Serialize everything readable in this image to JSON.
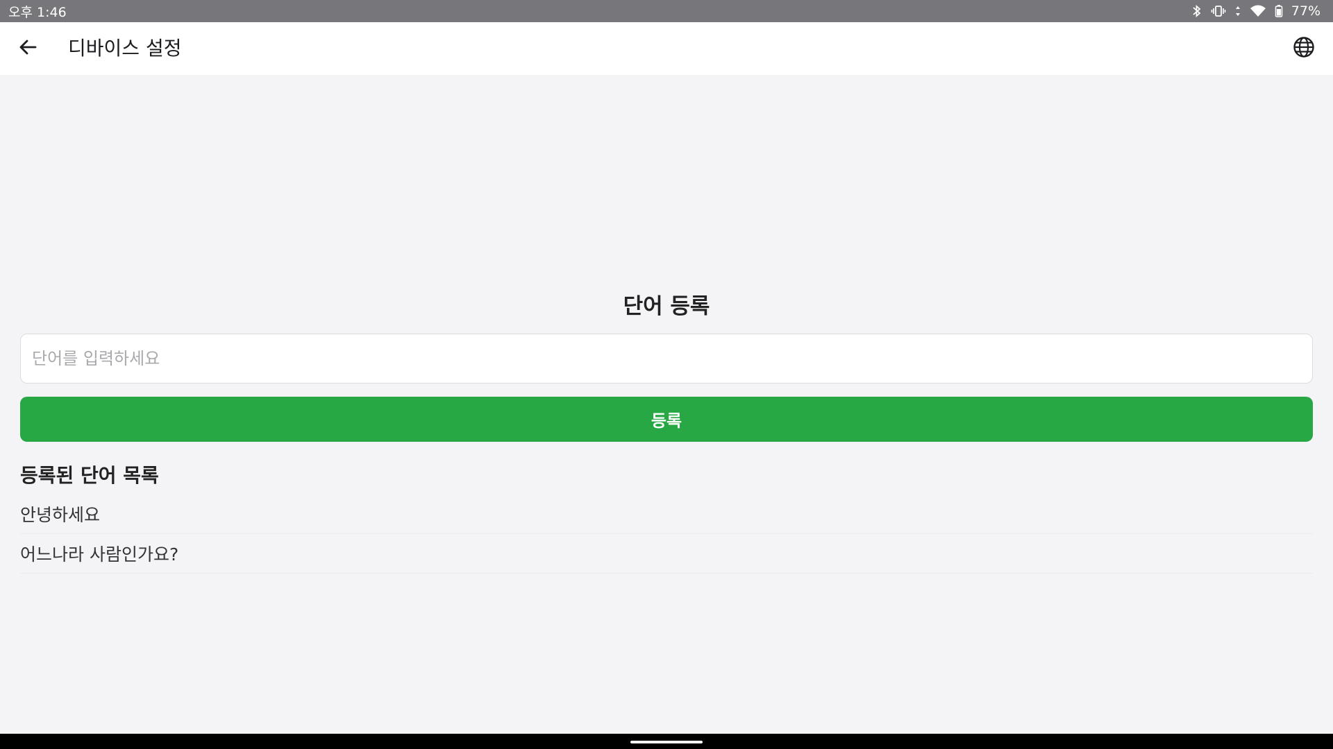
{
  "status_bar": {
    "time": "오후 1:46",
    "battery": "77%"
  },
  "app_bar": {
    "title": "디바이스 설정",
    "back_icon": "arrow-back-icon",
    "language_icon": "globe-icon"
  },
  "register": {
    "title": "단어 등록",
    "placeholder": "단어를 입력하세요",
    "value": "",
    "button_label": "등록"
  },
  "list": {
    "title": "등록된 단어 목록",
    "items": [
      "안녕하세요",
      "어느나라 사람인가요?"
    ]
  },
  "colors": {
    "accent": "#28a745",
    "status_bar": "#77767a",
    "background": "#f4f3f6"
  }
}
